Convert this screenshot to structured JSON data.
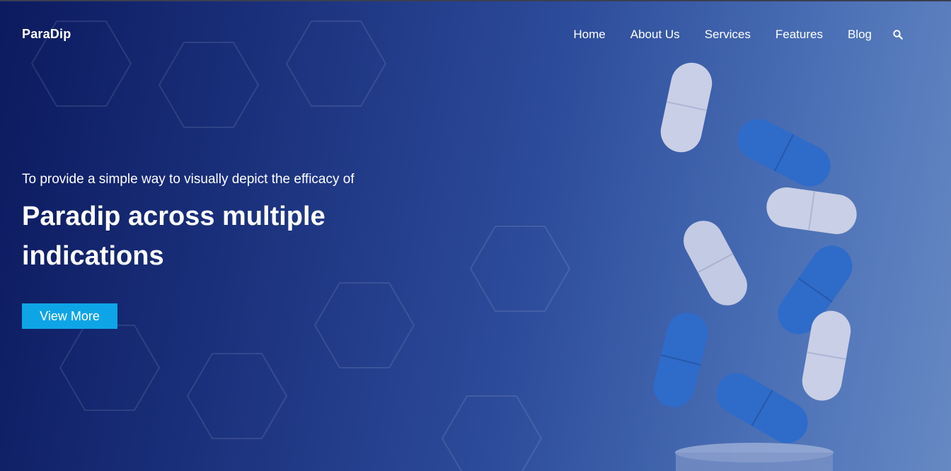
{
  "brand": {
    "logo_text": "ParaDip"
  },
  "nav": {
    "items": [
      {
        "label": "Home"
      },
      {
        "label": "About Us"
      },
      {
        "label": "Services"
      },
      {
        "label": "Features"
      },
      {
        "label": "Blog"
      }
    ],
    "search_icon": "search-icon"
  },
  "hero": {
    "subtitle": "To provide a simple way to visually depict the efficacy of",
    "headline": "Paradip across multiple indications",
    "cta_label": "View More"
  },
  "colors": {
    "gradient_start": "#0c1a5e",
    "gradient_end": "#6689c3",
    "cta_background": "#0ea5e6",
    "text": "#ffffff",
    "pill_blue": "#2f6bc9",
    "pill_white": "#c9cfe6"
  }
}
